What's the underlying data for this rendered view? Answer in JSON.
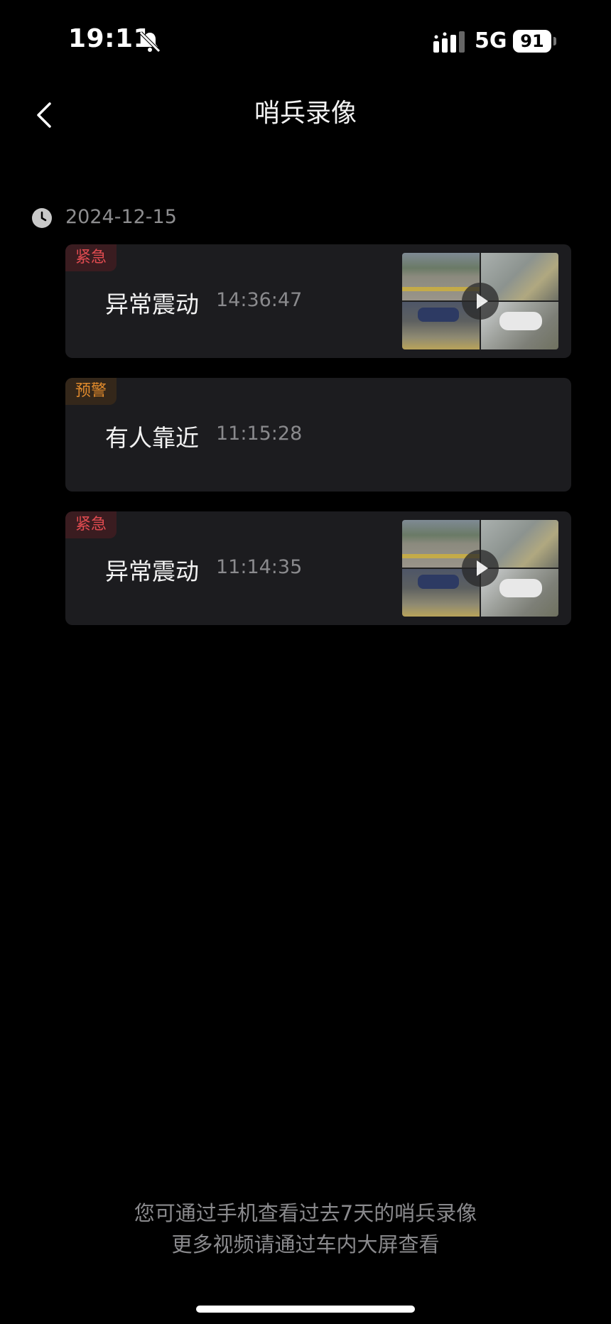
{
  "status_bar": {
    "time": "19:11",
    "network": "5G",
    "battery": "91",
    "icons": [
      "bell-muted-icon",
      "signal-icon",
      "battery-icon"
    ]
  },
  "nav": {
    "title": "哨兵录像",
    "back_icon": "chevron-left-icon"
  },
  "date_group": {
    "date": "2024-12-15",
    "icon": "clock-icon"
  },
  "events": [
    {
      "tag": "紧急",
      "level": "urgent",
      "name": "异常震动",
      "time": "14:36:47",
      "has_video": true
    },
    {
      "tag": "预警",
      "level": "warning",
      "name": "有人靠近",
      "time": "11:15:28",
      "has_video": false
    },
    {
      "tag": "紧急",
      "level": "urgent",
      "name": "异常震动",
      "time": "11:14:35",
      "has_video": true
    }
  ],
  "colors": {
    "urgent": "#e04b50",
    "warning": "#e08a2c",
    "card_bg": "#1c1c1f"
  },
  "footer": {
    "line1": "您可通过手机查看过去7天的哨兵录像",
    "line2": "更多视频请通过车内大屏查看"
  }
}
